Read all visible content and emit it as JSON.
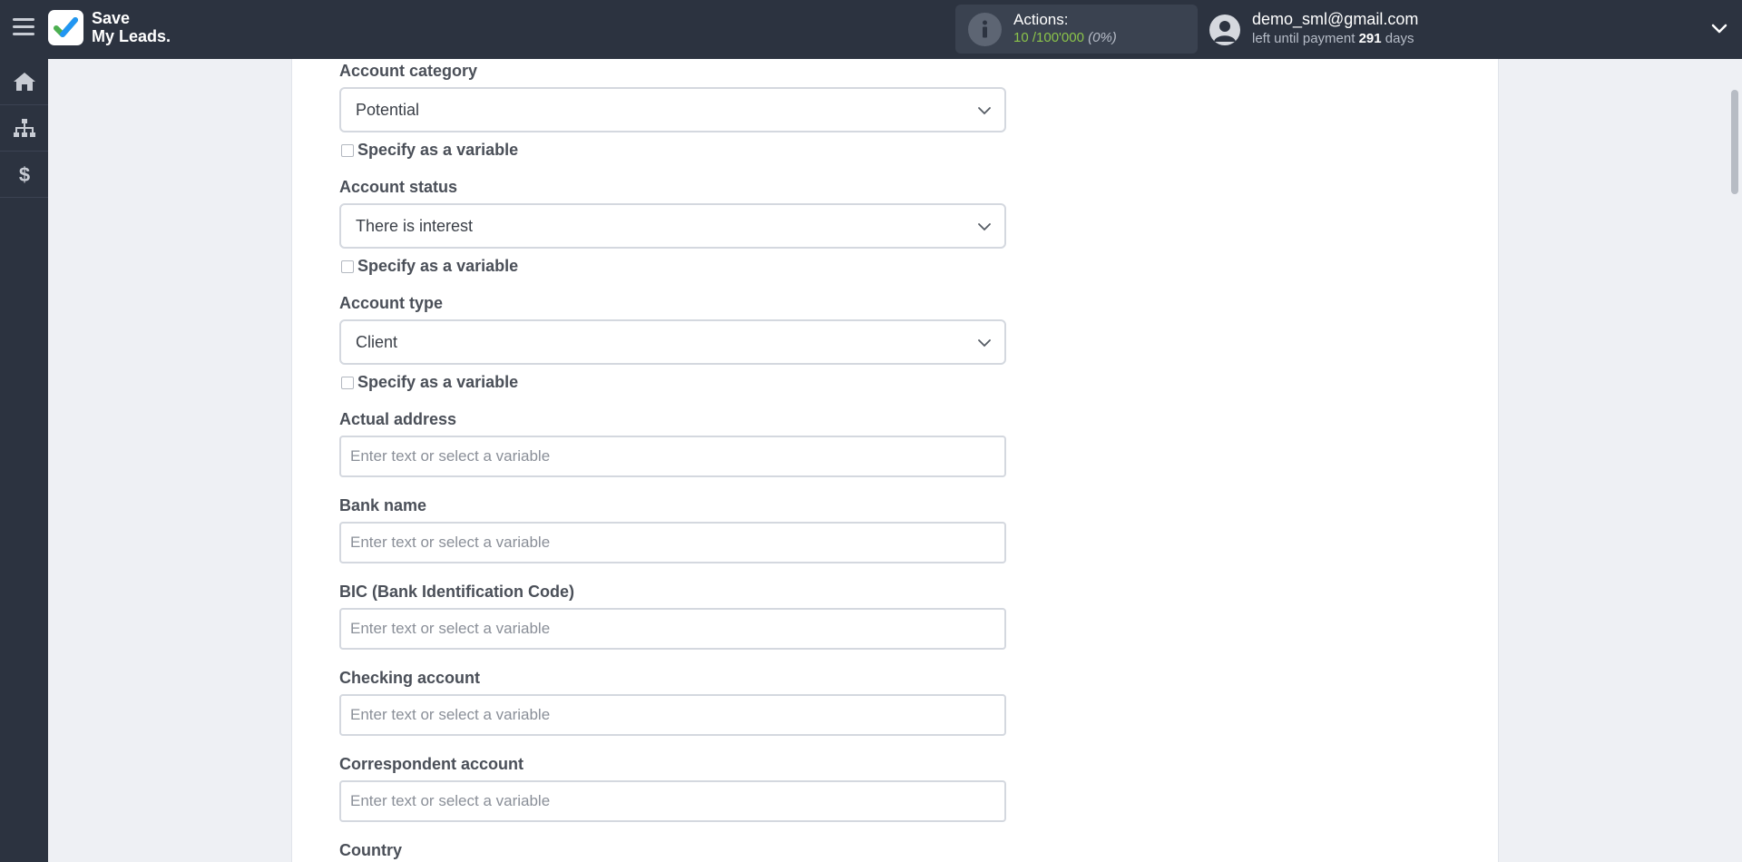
{
  "header": {
    "logo_line1": "Save",
    "logo_line2": "My Leads.",
    "actions_label": "Actions:",
    "actions_used": "10",
    "actions_total": "/100'000",
    "actions_percent": "(0%)",
    "user_email": "demo_sml@gmail.com",
    "payment_prefix": "left until payment",
    "payment_days": "291",
    "payment_suffix": "days"
  },
  "sidebar": {
    "items": [
      {
        "icon": "home-icon"
      },
      {
        "icon": "sitemap-icon"
      },
      {
        "icon": "dollar-icon"
      }
    ]
  },
  "form": {
    "account_category": {
      "label": "Account category",
      "value": "Potential",
      "variable_label": "Specify as a variable"
    },
    "account_status": {
      "label": "Account status",
      "value": "There is interest",
      "variable_label": "Specify as a variable"
    },
    "account_type": {
      "label": "Account type",
      "value": "Client",
      "variable_label": "Specify as a variable"
    },
    "actual_address": {
      "label": "Actual address",
      "placeholder": "Enter text or select a variable"
    },
    "bank_name": {
      "label": "Bank name",
      "placeholder": "Enter text or select a variable"
    },
    "bic": {
      "label": "BIC (Bank Identification Code)",
      "placeholder": "Enter text or select a variable"
    },
    "checking_account": {
      "label": "Checking account",
      "placeholder": "Enter text or select a variable"
    },
    "correspondent_account": {
      "label": "Correspondent account",
      "placeholder": "Enter text or select a variable"
    },
    "country": {
      "label": "Country"
    }
  },
  "colors": {
    "topbar": "#2c3340",
    "accent_green": "#8bc34a",
    "logo_check_blue": "#2196f3",
    "logo_check_green": "#4caf50"
  }
}
